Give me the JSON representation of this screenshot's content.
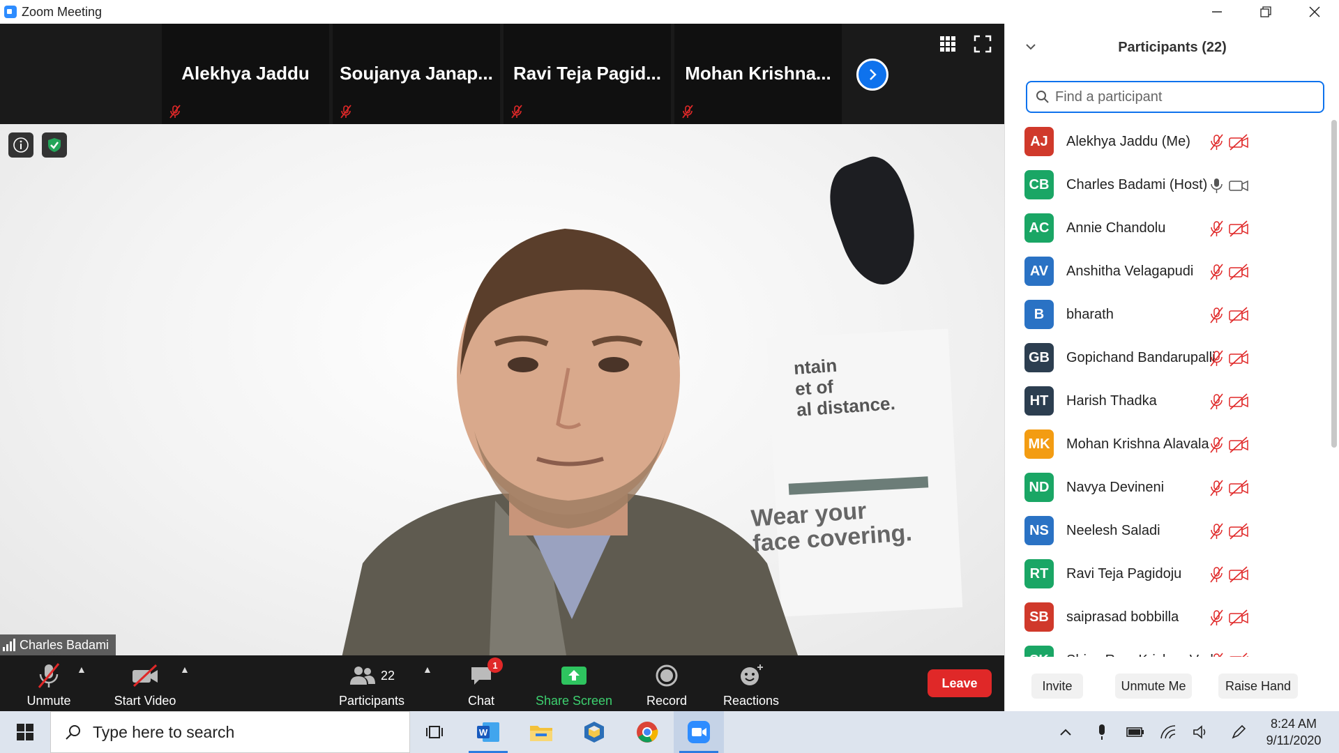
{
  "window": {
    "title": "Zoom Meeting"
  },
  "gallery": {
    "tiles": [
      {
        "name": "Alekhya Jaddu"
      },
      {
        "name": "Soujanya  Janap..."
      },
      {
        "name": "Ravi  Teja  Pagid..."
      },
      {
        "name": "Mohan  Krishna..."
      }
    ]
  },
  "video": {
    "speaker_name": "Charles Badami",
    "poster_text_1": "ntain\net of\nal distance.",
    "poster_text_2": "Wear your\nface covering."
  },
  "toolbar": {
    "unmute_label": "Unmute",
    "start_video_label": "Start Video",
    "participants_label": "Participants",
    "participants_count": "22",
    "chat_label": "Chat",
    "chat_badge": "1",
    "share_screen_label": "Share Screen",
    "record_label": "Record",
    "reactions_label": "Reactions",
    "leave_label": "Leave"
  },
  "panel": {
    "title": "Participants (22)",
    "search_placeholder": "Find a participant",
    "participants": [
      {
        "initials": "AJ",
        "name": "Alekhya Jaddu (Me)",
        "color": "#d0392b",
        "muted": true
      },
      {
        "initials": "CB",
        "name": "Charles Badami (Host)",
        "color": "#1aa665",
        "muted": false
      },
      {
        "initials": "AC",
        "name": "Annie Chandolu",
        "color": "#1aa665",
        "muted": true
      },
      {
        "initials": "AV",
        "name": "Anshitha Velagapudi",
        "color": "#2a72c4",
        "muted": true
      },
      {
        "initials": "B",
        "name": "bharath",
        "color": "#2a72c4",
        "muted": true
      },
      {
        "initials": "GB",
        "name": "Gopichand Bandarupalli",
        "color": "#2c3e50",
        "muted": true
      },
      {
        "initials": "HT",
        "name": "Harish Thadka",
        "color": "#2c3e50",
        "muted": true
      },
      {
        "initials": "MK",
        "name": "Mohan Krishna Alavala",
        "color": "#f39c12",
        "muted": true
      },
      {
        "initials": "ND",
        "name": "Navya Devineni",
        "color": "#1aa665",
        "muted": true
      },
      {
        "initials": "NS",
        "name": "Neelesh Saladi",
        "color": "#2a72c4",
        "muted": true
      },
      {
        "initials": "RT",
        "name": "Ravi Teja Pagidoju",
        "color": "#1aa665",
        "muted": true
      },
      {
        "initials": "SB",
        "name": "saiprasad bobbilla",
        "color": "#d0392b",
        "muted": true
      },
      {
        "initials": "SK",
        "name": "Shiva Ram Krishna Vadrapu",
        "color": "#1aa665",
        "muted": true
      }
    ],
    "invite_label": "Invite",
    "unmute_me_label": "Unmute Me",
    "raise_hand_label": "Raise Hand"
  },
  "taskbar": {
    "search_placeholder": "Type here to search",
    "time": "8:24 AM",
    "date": "9/11/2020"
  }
}
